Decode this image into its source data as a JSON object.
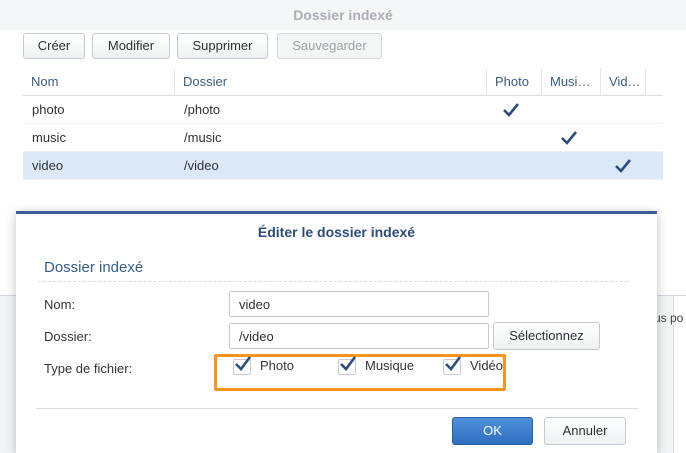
{
  "colors": {
    "accent": "#3b5e94",
    "highlight": "#f5941f",
    "selection": "#dbe8f7",
    "checkmark": "#2b4c7e"
  },
  "background": {
    "fragment_text": "us po"
  },
  "window": {
    "title": "Dossier indexé",
    "toolbar": {
      "create": "Créer",
      "modify": "Modifier",
      "delete": "Supprimer",
      "save": "Sauvegarder"
    },
    "table": {
      "headers": {
        "name": "Nom",
        "folder": "Dossier",
        "photo": "Photo",
        "music": "Musi…",
        "video": "Vid…"
      },
      "rows": [
        {
          "name": "photo",
          "folder": "/photo",
          "photo": true,
          "music": false,
          "video": false,
          "selected": false
        },
        {
          "name": "music",
          "folder": "/music",
          "photo": false,
          "music": true,
          "video": false,
          "selected": false
        },
        {
          "name": "video",
          "folder": "/video",
          "photo": false,
          "music": false,
          "video": true,
          "selected": true
        }
      ],
      "check_icon": "checkmark-icon"
    }
  },
  "dialog": {
    "title": "Éditer le dossier indexé",
    "section_title": "Dossier indexé",
    "name_label": "Nom:",
    "name_value": "video",
    "folder_label": "Dossier:",
    "folder_value": "/video",
    "select_button": "Sélectionnez",
    "filetype_label": "Type de fichier:",
    "filetypes": [
      {
        "label": "Photo",
        "checked": true
      },
      {
        "label": "Musique",
        "checked": true
      },
      {
        "label": "Vidéo",
        "checked": true
      }
    ],
    "ok_button": "OK",
    "cancel_button": "Annuler"
  }
}
